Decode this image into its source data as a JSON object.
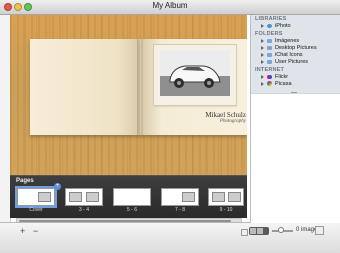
{
  "window": {
    "title": "My Album"
  },
  "book": {
    "caption_name": "Mikael Schulz",
    "caption_sub": "Photography"
  },
  "pages": {
    "label": "Pages",
    "spreads": [
      {
        "label": "Cover",
        "selected": true
      },
      {
        "label": "3 - 4",
        "selected": false
      },
      {
        "label": "5 - 6",
        "selected": false
      },
      {
        "label": "7 - 8",
        "selected": false
      },
      {
        "label": "9 - 10",
        "selected": false
      }
    ]
  },
  "bottombar": {
    "add_label": "+",
    "remove_label": "−",
    "count_text": "0 images"
  },
  "sidebar": {
    "sections": [
      {
        "title": "LIBRARIES",
        "items": [
          {
            "label": "iPhoto",
            "icon": "iphoto-icon"
          }
        ]
      },
      {
        "title": "FOLDERS",
        "items": [
          {
            "label": "Imágenes",
            "icon": "folder-icon"
          },
          {
            "label": "Desktop Pictures",
            "icon": "folder-icon"
          },
          {
            "label": "iChat Icons",
            "icon": "folder-icon"
          },
          {
            "label": "User Pictures",
            "icon": "folder-icon"
          }
        ]
      },
      {
        "title": "INTERNET",
        "items": [
          {
            "label": "Flickr",
            "icon": "flickr-icon"
          },
          {
            "label": "Picasa",
            "icon": "picasa-icon"
          }
        ]
      }
    ]
  }
}
